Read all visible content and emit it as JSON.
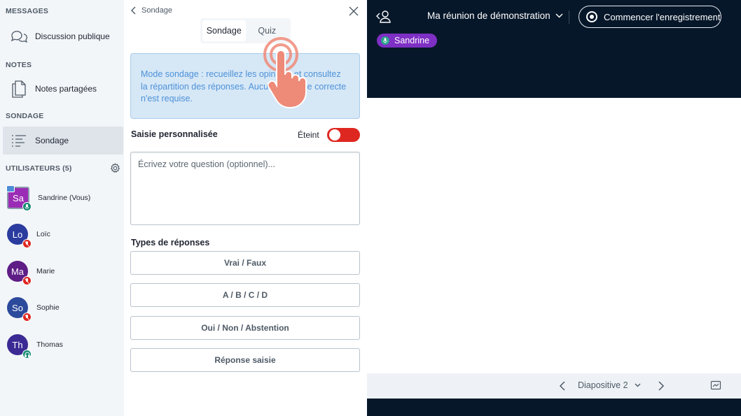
{
  "sidebar": {
    "messages_title": "MESSAGES",
    "public_chat_label": "Discussion publique",
    "notes_title": "NOTES",
    "shared_notes_label": "Notes partagées",
    "poll_title": "SONDAGE",
    "poll_label": "Sondage",
    "users_title": "UTILISATEURS (5)",
    "users": [
      {
        "initials": "Sa",
        "name": "Sandrine (Vous)",
        "color": "#9b2cb5",
        "badge_color": "#168a73",
        "status": "mic-on"
      },
      {
        "initials": "Lo",
        "name": "Loïc",
        "color": "#2b3c9e",
        "badge_color": "#df2721",
        "status": "mic-off"
      },
      {
        "initials": "Ma",
        "name": "Marie",
        "color": "#5e1e86",
        "badge_color": "#df2721",
        "status": "mic-off"
      },
      {
        "initials": "So",
        "name": "Sophie",
        "color": "#2c4a9c",
        "badge_color": "#df2721",
        "status": "mic-off"
      },
      {
        "initials": "Th",
        "name": "Thomas",
        "color": "#3b2a94",
        "badge_color": "#168a73",
        "status": "listen-only"
      }
    ]
  },
  "poll_panel": {
    "back_label": "Sondage",
    "tabs": [
      "Sondage",
      "Quiz"
    ],
    "active_tab": "Sondage",
    "info_text": "Mode sondage : recueillez les opinions et consultez la répartition des réponses. Aucune réponse correcte n'est requise.",
    "custom_input_label": "Saisie personnalisée",
    "toggle_state_label": "Éteint",
    "question_placeholder": "Écrivez votre question (optionnel)...",
    "response_types_label": "Types de réponses",
    "response_types": [
      "Vrai / Faux",
      "A / B / C / D",
      "Oui / Non / Abstention",
      "Réponse saisie"
    ]
  },
  "meeting": {
    "title": "Ma réunion de démonstration",
    "record_label": "Commencer l'enregistrement",
    "talking_user": "Sandrine",
    "slide_label": "Diapositive 2"
  },
  "colors": {
    "accent_purple": "#7e2fc4",
    "toggle_red": "#df2721",
    "dark_bg": "#06172a",
    "info_blue": "#4d92d8"
  }
}
